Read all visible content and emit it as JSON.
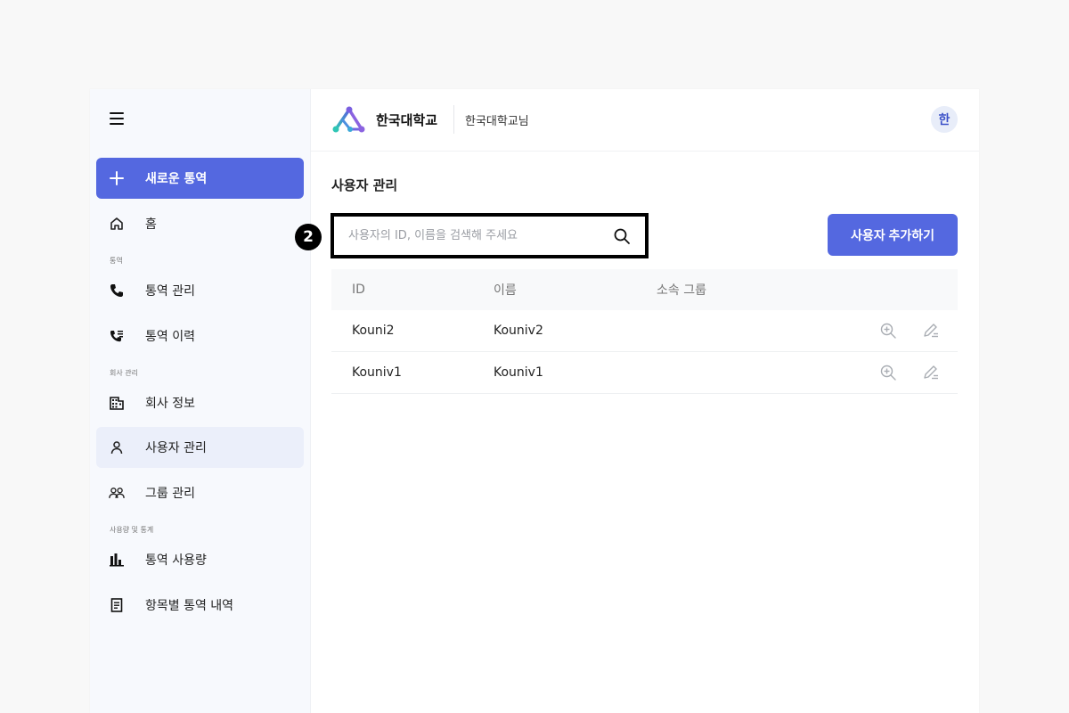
{
  "sidebar": {
    "new_button": "새로운 통역",
    "home": "홈",
    "sections": {
      "interpretation": "통역",
      "company": "회사 관리",
      "usage": "사용량 및 통계"
    },
    "items": {
      "interpretation_manage": "통역 관리",
      "interpretation_history": "통역 이력",
      "company_info": "회사 정보",
      "user_manage": "사용자 관리",
      "group_manage": "그룹 관리",
      "usage_stats": "통역 사용량",
      "itemized_history": "항목별 통역 내역"
    }
  },
  "header": {
    "brand": "한국대학교",
    "user_label": "한국대학교님",
    "avatar_initial": "한"
  },
  "main": {
    "title": "사용자 관리",
    "search_placeholder": "사용자의 ID, 이름을 검색해 주세요",
    "step_badge": "2",
    "add_user_button": "사용자 추가하기",
    "table": {
      "headers": {
        "id": "ID",
        "name": "이름",
        "group": "소속 그룹"
      },
      "rows": [
        {
          "id": "Kouni2",
          "name": "Kouniv2",
          "group": ""
        },
        {
          "id": "Kouniv1",
          "name": "Kouniv1",
          "group": ""
        }
      ]
    }
  },
  "colors": {
    "accent": "#5468e0",
    "sidebar_bg": "#f7f9fd",
    "active_bg": "#ebeffa"
  }
}
